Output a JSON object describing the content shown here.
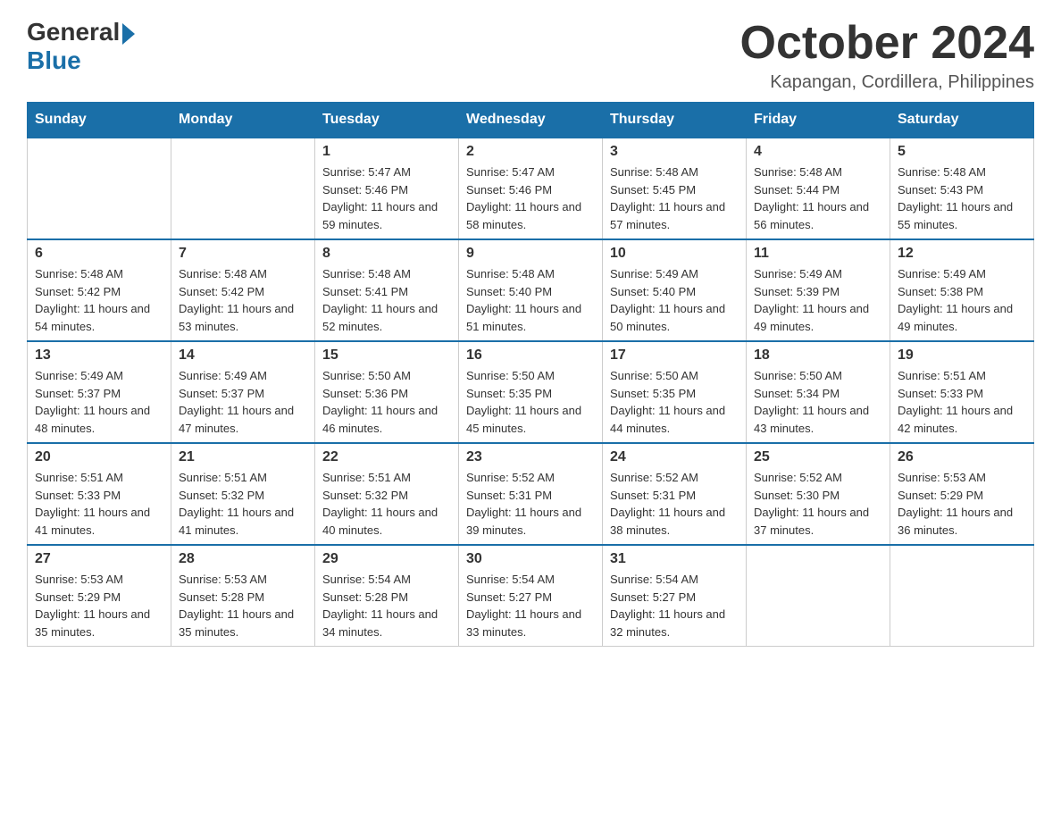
{
  "header": {
    "logo_general": "General",
    "logo_blue": "Blue",
    "month_year": "October 2024",
    "location": "Kapangan, Cordillera, Philippines"
  },
  "weekdays": [
    "Sunday",
    "Monday",
    "Tuesday",
    "Wednesday",
    "Thursday",
    "Friday",
    "Saturday"
  ],
  "weeks": [
    [
      {
        "day": "",
        "sunrise": "",
        "sunset": "",
        "daylight": ""
      },
      {
        "day": "",
        "sunrise": "",
        "sunset": "",
        "daylight": ""
      },
      {
        "day": "1",
        "sunrise": "Sunrise: 5:47 AM",
        "sunset": "Sunset: 5:46 PM",
        "daylight": "Daylight: 11 hours and 59 minutes."
      },
      {
        "day": "2",
        "sunrise": "Sunrise: 5:47 AM",
        "sunset": "Sunset: 5:46 PM",
        "daylight": "Daylight: 11 hours and 58 minutes."
      },
      {
        "day": "3",
        "sunrise": "Sunrise: 5:48 AM",
        "sunset": "Sunset: 5:45 PM",
        "daylight": "Daylight: 11 hours and 57 minutes."
      },
      {
        "day": "4",
        "sunrise": "Sunrise: 5:48 AM",
        "sunset": "Sunset: 5:44 PM",
        "daylight": "Daylight: 11 hours and 56 minutes."
      },
      {
        "day": "5",
        "sunrise": "Sunrise: 5:48 AM",
        "sunset": "Sunset: 5:43 PM",
        "daylight": "Daylight: 11 hours and 55 minutes."
      }
    ],
    [
      {
        "day": "6",
        "sunrise": "Sunrise: 5:48 AM",
        "sunset": "Sunset: 5:42 PM",
        "daylight": "Daylight: 11 hours and 54 minutes."
      },
      {
        "day": "7",
        "sunrise": "Sunrise: 5:48 AM",
        "sunset": "Sunset: 5:42 PM",
        "daylight": "Daylight: 11 hours and 53 minutes."
      },
      {
        "day": "8",
        "sunrise": "Sunrise: 5:48 AM",
        "sunset": "Sunset: 5:41 PM",
        "daylight": "Daylight: 11 hours and 52 minutes."
      },
      {
        "day": "9",
        "sunrise": "Sunrise: 5:48 AM",
        "sunset": "Sunset: 5:40 PM",
        "daylight": "Daylight: 11 hours and 51 minutes."
      },
      {
        "day": "10",
        "sunrise": "Sunrise: 5:49 AM",
        "sunset": "Sunset: 5:40 PM",
        "daylight": "Daylight: 11 hours and 50 minutes."
      },
      {
        "day": "11",
        "sunrise": "Sunrise: 5:49 AM",
        "sunset": "Sunset: 5:39 PM",
        "daylight": "Daylight: 11 hours and 49 minutes."
      },
      {
        "day": "12",
        "sunrise": "Sunrise: 5:49 AM",
        "sunset": "Sunset: 5:38 PM",
        "daylight": "Daylight: 11 hours and 49 minutes."
      }
    ],
    [
      {
        "day": "13",
        "sunrise": "Sunrise: 5:49 AM",
        "sunset": "Sunset: 5:37 PM",
        "daylight": "Daylight: 11 hours and 48 minutes."
      },
      {
        "day": "14",
        "sunrise": "Sunrise: 5:49 AM",
        "sunset": "Sunset: 5:37 PM",
        "daylight": "Daylight: 11 hours and 47 minutes."
      },
      {
        "day": "15",
        "sunrise": "Sunrise: 5:50 AM",
        "sunset": "Sunset: 5:36 PM",
        "daylight": "Daylight: 11 hours and 46 minutes."
      },
      {
        "day": "16",
        "sunrise": "Sunrise: 5:50 AM",
        "sunset": "Sunset: 5:35 PM",
        "daylight": "Daylight: 11 hours and 45 minutes."
      },
      {
        "day": "17",
        "sunrise": "Sunrise: 5:50 AM",
        "sunset": "Sunset: 5:35 PM",
        "daylight": "Daylight: 11 hours and 44 minutes."
      },
      {
        "day": "18",
        "sunrise": "Sunrise: 5:50 AM",
        "sunset": "Sunset: 5:34 PM",
        "daylight": "Daylight: 11 hours and 43 minutes."
      },
      {
        "day": "19",
        "sunrise": "Sunrise: 5:51 AM",
        "sunset": "Sunset: 5:33 PM",
        "daylight": "Daylight: 11 hours and 42 minutes."
      }
    ],
    [
      {
        "day": "20",
        "sunrise": "Sunrise: 5:51 AM",
        "sunset": "Sunset: 5:33 PM",
        "daylight": "Daylight: 11 hours and 41 minutes."
      },
      {
        "day": "21",
        "sunrise": "Sunrise: 5:51 AM",
        "sunset": "Sunset: 5:32 PM",
        "daylight": "Daylight: 11 hours and 41 minutes."
      },
      {
        "day": "22",
        "sunrise": "Sunrise: 5:51 AM",
        "sunset": "Sunset: 5:32 PM",
        "daylight": "Daylight: 11 hours and 40 minutes."
      },
      {
        "day": "23",
        "sunrise": "Sunrise: 5:52 AM",
        "sunset": "Sunset: 5:31 PM",
        "daylight": "Daylight: 11 hours and 39 minutes."
      },
      {
        "day": "24",
        "sunrise": "Sunrise: 5:52 AM",
        "sunset": "Sunset: 5:31 PM",
        "daylight": "Daylight: 11 hours and 38 minutes."
      },
      {
        "day": "25",
        "sunrise": "Sunrise: 5:52 AM",
        "sunset": "Sunset: 5:30 PM",
        "daylight": "Daylight: 11 hours and 37 minutes."
      },
      {
        "day": "26",
        "sunrise": "Sunrise: 5:53 AM",
        "sunset": "Sunset: 5:29 PM",
        "daylight": "Daylight: 11 hours and 36 minutes."
      }
    ],
    [
      {
        "day": "27",
        "sunrise": "Sunrise: 5:53 AM",
        "sunset": "Sunset: 5:29 PM",
        "daylight": "Daylight: 11 hours and 35 minutes."
      },
      {
        "day": "28",
        "sunrise": "Sunrise: 5:53 AM",
        "sunset": "Sunset: 5:28 PM",
        "daylight": "Daylight: 11 hours and 35 minutes."
      },
      {
        "day": "29",
        "sunrise": "Sunrise: 5:54 AM",
        "sunset": "Sunset: 5:28 PM",
        "daylight": "Daylight: 11 hours and 34 minutes."
      },
      {
        "day": "30",
        "sunrise": "Sunrise: 5:54 AM",
        "sunset": "Sunset: 5:27 PM",
        "daylight": "Daylight: 11 hours and 33 minutes."
      },
      {
        "day": "31",
        "sunrise": "Sunrise: 5:54 AM",
        "sunset": "Sunset: 5:27 PM",
        "daylight": "Daylight: 11 hours and 32 minutes."
      },
      {
        "day": "",
        "sunrise": "",
        "sunset": "",
        "daylight": ""
      },
      {
        "day": "",
        "sunrise": "",
        "sunset": "",
        "daylight": ""
      }
    ]
  ]
}
